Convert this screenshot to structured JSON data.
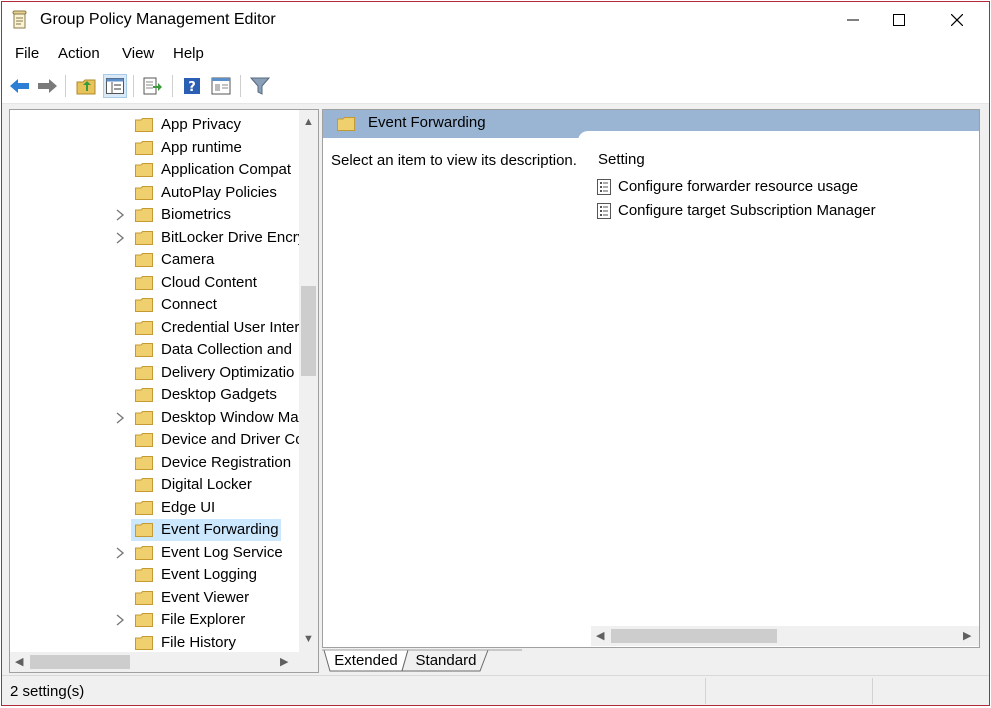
{
  "window": {
    "title": "Group Policy Management Editor",
    "app_icon": "policy-scroll-icon",
    "controls": [
      "minimize-icon",
      "maximize-icon",
      "close-icon"
    ]
  },
  "menu": {
    "items": [
      "File",
      "Action",
      "View",
      "Help"
    ]
  },
  "toolbar": {
    "buttons": [
      "back-arrow-icon",
      "forward-arrow-icon",
      "up-folder-icon",
      "show-hide-tree-icon",
      "export-list-icon",
      "help-icon",
      "properties-icon",
      "filter-icon"
    ]
  },
  "tree": {
    "items": [
      {
        "label": "App Privacy",
        "expandable": false
      },
      {
        "label": "App runtime",
        "expandable": false
      },
      {
        "label": "Application Compat",
        "expandable": false
      },
      {
        "label": "AutoPlay Policies",
        "expandable": false
      },
      {
        "label": "Biometrics",
        "expandable": true
      },
      {
        "label": "BitLocker Drive Encry",
        "expandable": true
      },
      {
        "label": "Camera",
        "expandable": false
      },
      {
        "label": "Cloud Content",
        "expandable": false
      },
      {
        "label": "Connect",
        "expandable": false
      },
      {
        "label": "Credential User Inter",
        "expandable": false
      },
      {
        "label": "Data Collection and",
        "expandable": false
      },
      {
        "label": "Delivery Optimizatio",
        "expandable": false
      },
      {
        "label": "Desktop Gadgets",
        "expandable": false
      },
      {
        "label": "Desktop Window Ma",
        "expandable": true
      },
      {
        "label": "Device and Driver Co",
        "expandable": false
      },
      {
        "label": "Device Registration",
        "expandable": false
      },
      {
        "label": "Digital Locker",
        "expandable": false
      },
      {
        "label": "Edge UI",
        "expandable": false
      },
      {
        "label": "Event Forwarding",
        "expandable": false,
        "selected": true
      },
      {
        "label": "Event Log Service",
        "expandable": true
      },
      {
        "label": "Event Logging",
        "expandable": false
      },
      {
        "label": "Event Viewer",
        "expandable": false
      },
      {
        "label": "File Explorer",
        "expandable": true
      },
      {
        "label": "File History",
        "expandable": false
      }
    ]
  },
  "details": {
    "header_title": "Event Forwarding",
    "description": "Select an item to view its description.",
    "setting_column": "Setting",
    "settings": [
      "Configure forwarder resource usage",
      "Configure target Subscription Manager"
    ]
  },
  "tabs": [
    "Extended",
    "Standard"
  ],
  "status": {
    "text": "2 setting(s)"
  },
  "colors": {
    "window_border": "#b1293b",
    "header_band": "#9ab5d3",
    "selection": "#cce8ff",
    "folder": "#e8c35a"
  }
}
